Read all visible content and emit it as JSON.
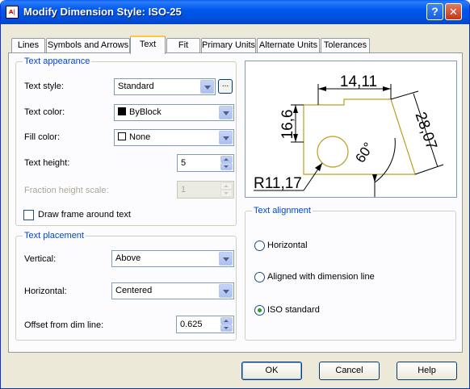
{
  "window": {
    "title": "Modify Dimension Style: ISO-25",
    "help_glyph": "?",
    "close_glyph": "✕",
    "icon": "autocad-dimstyle-icon"
  },
  "tabs": [
    {
      "label": "Lines"
    },
    {
      "label": "Symbols and Arrows"
    },
    {
      "label": "Text",
      "active": true
    },
    {
      "label": "Fit"
    },
    {
      "label": "Primary Units"
    },
    {
      "label": "Alternate Units"
    },
    {
      "label": "Tolerances"
    }
  ],
  "text_appearance": {
    "title": "Text appearance",
    "text_style_label": "Text style:",
    "text_style_value": "Standard",
    "browse_label": "...",
    "text_color_label": "Text color:",
    "text_color_value": "ByBlock",
    "text_color_swatch": "#000000",
    "fill_color_label": "Fill color:",
    "fill_color_value": "None",
    "fill_color_swatch": "#ffffff",
    "text_height_label": "Text height:",
    "text_height_value": "5",
    "fraction_label": "Fraction height scale:",
    "fraction_value": "1",
    "frame_label": "Draw frame around text",
    "frame_checked": false
  },
  "text_placement": {
    "title": "Text placement",
    "vertical_label": "Vertical:",
    "vertical_value": "Above",
    "horizontal_label": "Horizontal:",
    "horizontal_value": "Centered",
    "offset_label": "Offset from dim line:",
    "offset_value": "0.625"
  },
  "text_alignment": {
    "title": "Text alignment",
    "options": [
      {
        "label": "Horizontal",
        "checked": false
      },
      {
        "label": "Aligned with dimension line",
        "checked": false
      },
      {
        "label": "ISO standard",
        "checked": true
      }
    ]
  },
  "preview": {
    "dim_top": "14,11",
    "dim_left": "16,6",
    "dim_right": "28,07",
    "dim_angle": "60°",
    "dim_radius": "R11,17",
    "part_color": "#b8a020"
  },
  "buttons": {
    "ok": "OK",
    "cancel": "Cancel",
    "help": "Help"
  }
}
